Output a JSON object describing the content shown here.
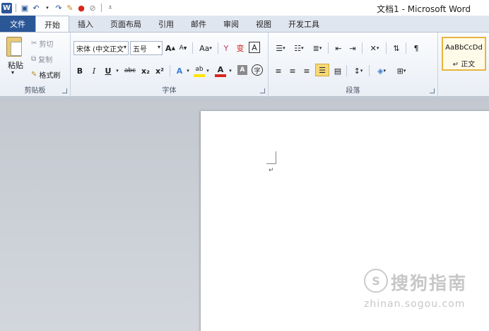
{
  "window": {
    "title": "文档1 - Microsoft Word"
  },
  "qat": {
    "logo": "W",
    "icons": [
      "save-icon",
      "undo-icon",
      "redo-icon",
      "format-painter-icon",
      "color-icon",
      "clear-icon",
      "customize-icon"
    ]
  },
  "tabs": [
    {
      "label": "文件",
      "active": false
    },
    {
      "label": "开始",
      "active": true
    },
    {
      "label": "插入",
      "active": false
    },
    {
      "label": "页面布局",
      "active": false
    },
    {
      "label": "引用",
      "active": false
    },
    {
      "label": "邮件",
      "active": false
    },
    {
      "label": "审阅",
      "active": false
    },
    {
      "label": "视图",
      "active": false
    },
    {
      "label": "开发工具",
      "active": false
    }
  ],
  "clipboard": {
    "group_label": "剪贴板",
    "paste": "粘贴",
    "cut": "剪切",
    "copy": "复制",
    "format_painter": "格式刷"
  },
  "font": {
    "group_label": "字体",
    "font_name": "宋体 (中文正文",
    "font_size": "五号",
    "grow": "A",
    "shrink": "A",
    "change_case": "Aa",
    "phonetic": "变",
    "char_border": "A",
    "bold": "B",
    "italic": "I",
    "underline": "U",
    "strike": "abc",
    "subscript": "x₂",
    "superscript": "x²",
    "text_effects": "A",
    "font_color": "A",
    "char_shading": "A",
    "enclose": "字"
  },
  "paragraph": {
    "group_label": "段落"
  },
  "styles": {
    "sample": "AaBbCcDd",
    "name": "↵ 正文"
  },
  "document": {
    "paragraph_mark": "↵"
  },
  "watermark": {
    "symbol": "S",
    "text": "搜狗指南",
    "url": "zhinan.sogou.com"
  },
  "colors": {
    "file_tab": "#2b5797",
    "accent_highlight": "#f7d878",
    "text_effect": "#3b7fd6",
    "font_color": "#d9261c",
    "highlight": "#ffe500"
  }
}
